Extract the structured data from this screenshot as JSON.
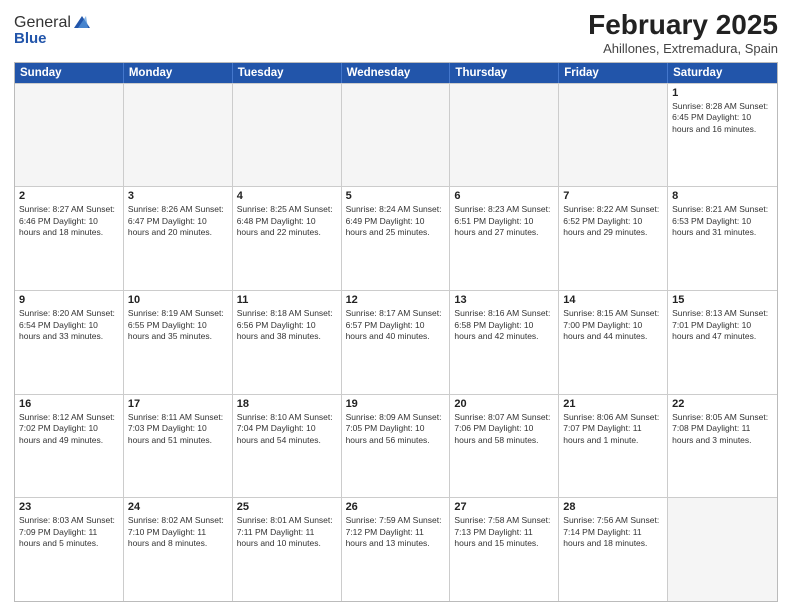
{
  "logo": {
    "general": "General",
    "blue": "Blue"
  },
  "header": {
    "month": "February 2025",
    "location": "Ahillones, Extremadura, Spain"
  },
  "days": [
    "Sunday",
    "Monday",
    "Tuesday",
    "Wednesday",
    "Thursday",
    "Friday",
    "Saturday"
  ],
  "weeks": [
    [
      {
        "day": "",
        "info": ""
      },
      {
        "day": "",
        "info": ""
      },
      {
        "day": "",
        "info": ""
      },
      {
        "day": "",
        "info": ""
      },
      {
        "day": "",
        "info": ""
      },
      {
        "day": "",
        "info": ""
      },
      {
        "day": "1",
        "info": "Sunrise: 8:28 AM\nSunset: 6:45 PM\nDaylight: 10 hours and 16 minutes."
      }
    ],
    [
      {
        "day": "2",
        "info": "Sunrise: 8:27 AM\nSunset: 6:46 PM\nDaylight: 10 hours and 18 minutes."
      },
      {
        "day": "3",
        "info": "Sunrise: 8:26 AM\nSunset: 6:47 PM\nDaylight: 10 hours and 20 minutes."
      },
      {
        "day": "4",
        "info": "Sunrise: 8:25 AM\nSunset: 6:48 PM\nDaylight: 10 hours and 22 minutes."
      },
      {
        "day": "5",
        "info": "Sunrise: 8:24 AM\nSunset: 6:49 PM\nDaylight: 10 hours and 25 minutes."
      },
      {
        "day": "6",
        "info": "Sunrise: 8:23 AM\nSunset: 6:51 PM\nDaylight: 10 hours and 27 minutes."
      },
      {
        "day": "7",
        "info": "Sunrise: 8:22 AM\nSunset: 6:52 PM\nDaylight: 10 hours and 29 minutes."
      },
      {
        "day": "8",
        "info": "Sunrise: 8:21 AM\nSunset: 6:53 PM\nDaylight: 10 hours and 31 minutes."
      }
    ],
    [
      {
        "day": "9",
        "info": "Sunrise: 8:20 AM\nSunset: 6:54 PM\nDaylight: 10 hours and 33 minutes."
      },
      {
        "day": "10",
        "info": "Sunrise: 8:19 AM\nSunset: 6:55 PM\nDaylight: 10 hours and 35 minutes."
      },
      {
        "day": "11",
        "info": "Sunrise: 8:18 AM\nSunset: 6:56 PM\nDaylight: 10 hours and 38 minutes."
      },
      {
        "day": "12",
        "info": "Sunrise: 8:17 AM\nSunset: 6:57 PM\nDaylight: 10 hours and 40 minutes."
      },
      {
        "day": "13",
        "info": "Sunrise: 8:16 AM\nSunset: 6:58 PM\nDaylight: 10 hours and 42 minutes."
      },
      {
        "day": "14",
        "info": "Sunrise: 8:15 AM\nSunset: 7:00 PM\nDaylight: 10 hours and 44 minutes."
      },
      {
        "day": "15",
        "info": "Sunrise: 8:13 AM\nSunset: 7:01 PM\nDaylight: 10 hours and 47 minutes."
      }
    ],
    [
      {
        "day": "16",
        "info": "Sunrise: 8:12 AM\nSunset: 7:02 PM\nDaylight: 10 hours and 49 minutes."
      },
      {
        "day": "17",
        "info": "Sunrise: 8:11 AM\nSunset: 7:03 PM\nDaylight: 10 hours and 51 minutes."
      },
      {
        "day": "18",
        "info": "Sunrise: 8:10 AM\nSunset: 7:04 PM\nDaylight: 10 hours and 54 minutes."
      },
      {
        "day": "19",
        "info": "Sunrise: 8:09 AM\nSunset: 7:05 PM\nDaylight: 10 hours and 56 minutes."
      },
      {
        "day": "20",
        "info": "Sunrise: 8:07 AM\nSunset: 7:06 PM\nDaylight: 10 hours and 58 minutes."
      },
      {
        "day": "21",
        "info": "Sunrise: 8:06 AM\nSunset: 7:07 PM\nDaylight: 11 hours and 1 minute."
      },
      {
        "day": "22",
        "info": "Sunrise: 8:05 AM\nSunset: 7:08 PM\nDaylight: 11 hours and 3 minutes."
      }
    ],
    [
      {
        "day": "23",
        "info": "Sunrise: 8:03 AM\nSunset: 7:09 PM\nDaylight: 11 hours and 5 minutes."
      },
      {
        "day": "24",
        "info": "Sunrise: 8:02 AM\nSunset: 7:10 PM\nDaylight: 11 hours and 8 minutes."
      },
      {
        "day": "25",
        "info": "Sunrise: 8:01 AM\nSunset: 7:11 PM\nDaylight: 11 hours and 10 minutes."
      },
      {
        "day": "26",
        "info": "Sunrise: 7:59 AM\nSunset: 7:12 PM\nDaylight: 11 hours and 13 minutes."
      },
      {
        "day": "27",
        "info": "Sunrise: 7:58 AM\nSunset: 7:13 PM\nDaylight: 11 hours and 15 minutes."
      },
      {
        "day": "28",
        "info": "Sunrise: 7:56 AM\nSunset: 7:14 PM\nDaylight: 11 hours and 18 minutes."
      },
      {
        "day": "",
        "info": ""
      }
    ]
  ]
}
